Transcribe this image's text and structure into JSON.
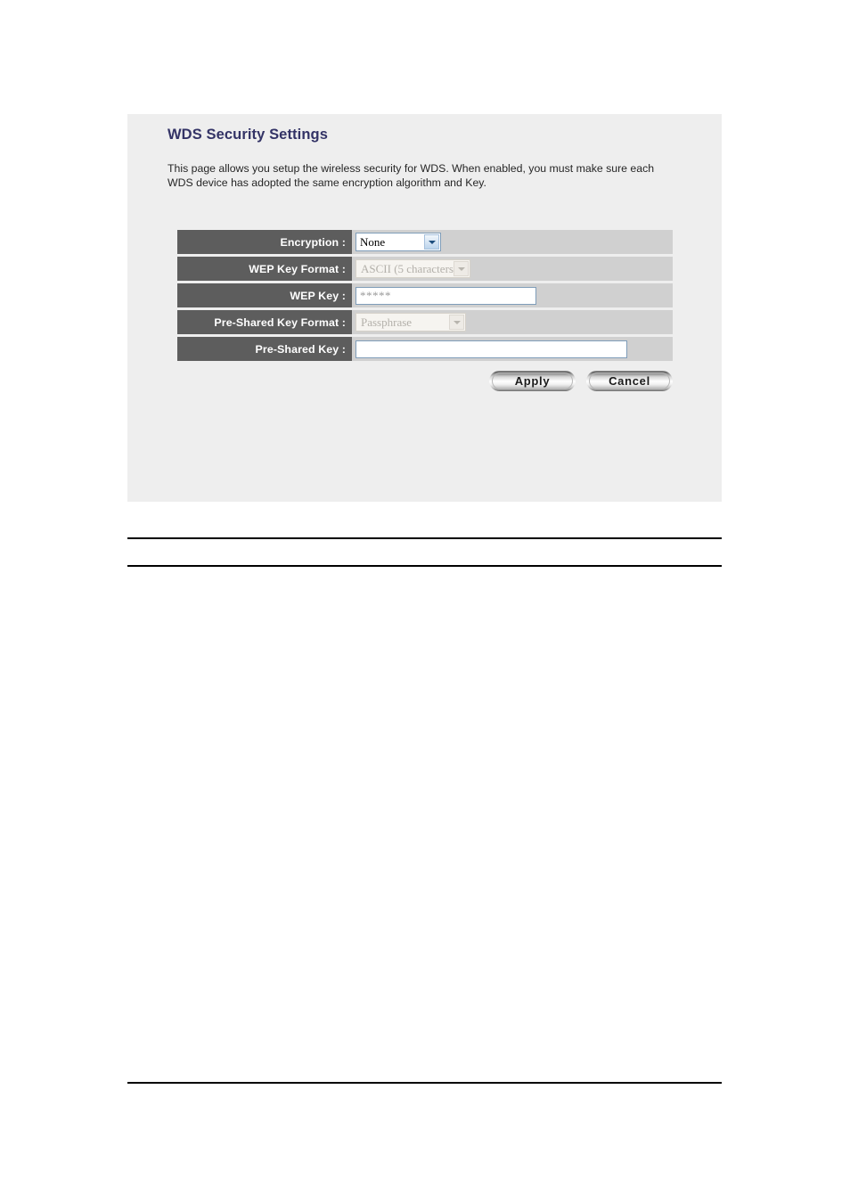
{
  "panel": {
    "title": "WDS Security Settings",
    "description": "This page allows you setup the wireless security for WDS. When enabled, you must make sure each WDS device has adopted the same encryption algorithm and Key.",
    "colors": {
      "panel_background": "#eeeeee",
      "title_text": "#333366",
      "label_cell": "#5d5d5d",
      "value_cell": "#d0d0d0",
      "input_border": "#7f9db9",
      "disabled_text": "#b3b0aa"
    }
  },
  "form": {
    "rows": [
      {
        "label": "Encryption :",
        "control": "select",
        "value": "None",
        "disabled": false,
        "icon": "chevron-down-icon",
        "name": "encryption"
      },
      {
        "label": "WEP Key Format :",
        "control": "select",
        "value": "ASCII (5 characters)",
        "disabled": true,
        "icon": "chevron-down-icon",
        "name": "wep-key-format"
      },
      {
        "label": "WEP Key :",
        "control": "text",
        "value": "*****",
        "placeholder": "",
        "disabled": false,
        "name": "wep-key"
      },
      {
        "label": "Pre-Shared Key Format :",
        "control": "select",
        "value": "Passphrase",
        "disabled": true,
        "icon": "chevron-down-icon",
        "name": "pre-shared-key-format"
      },
      {
        "label": "Pre-Shared Key :",
        "control": "text",
        "value": "",
        "placeholder": "",
        "disabled": false,
        "name": "pre-shared-key"
      }
    ]
  },
  "buttons": {
    "apply_label": "Apply",
    "cancel_label": "Cancel"
  }
}
